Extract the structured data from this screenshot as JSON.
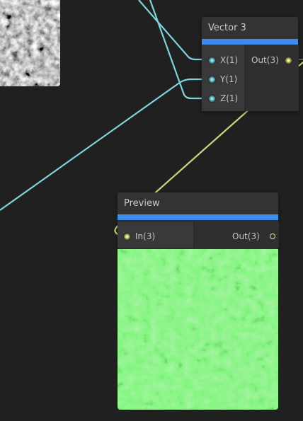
{
  "canvas": {
    "background": "#202020"
  },
  "colors": {
    "accent": "#3d8bea",
    "wire_vector1": "#7fd3dc",
    "wire_vector3": "#cfd27a",
    "preview_green": "#3bc43b"
  },
  "vector3_node": {
    "title": "Vector 3",
    "inputs": [
      {
        "label": "X(1)",
        "type": "vector1"
      },
      {
        "label": "Y(1)",
        "type": "vector1"
      },
      {
        "label": "Z(1)",
        "type": "vector1"
      }
    ],
    "output": {
      "label": "Out(3)",
      "type": "vector3"
    }
  },
  "preview_node": {
    "title": "Preview",
    "input": {
      "label": "In(3)",
      "type": "vector3"
    },
    "output": {
      "label": "Out(3)",
      "type": "vector3"
    }
  }
}
